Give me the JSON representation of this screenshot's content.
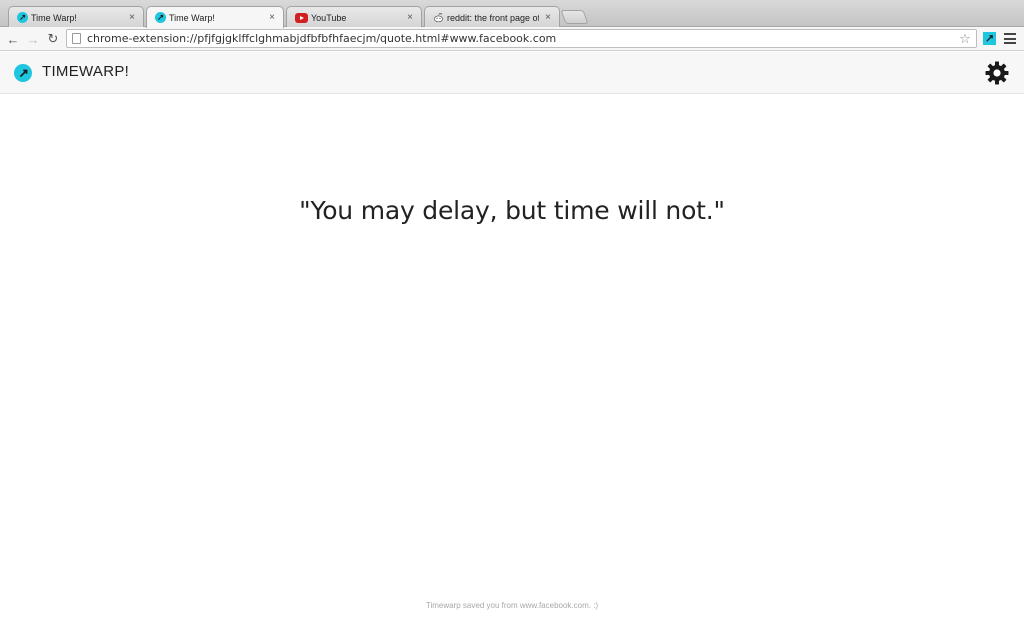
{
  "tabs": [
    {
      "title": "Time Warp!",
      "icon": "timewarp-favicon",
      "active": false
    },
    {
      "title": "Time Warp!",
      "icon": "timewarp-favicon",
      "active": true
    },
    {
      "title": "YouTube",
      "icon": "youtube-favicon",
      "active": false
    },
    {
      "title": "reddit: the front page of th",
      "icon": "reddit-favicon",
      "active": false
    }
  ],
  "tab_close_glyph": "×",
  "toolbar": {
    "url": "chrome-extension://pfjfgjgklffclghmabjdfbfbfhfaecjm/quote.html#www.facebook.com",
    "back_glyph": "←",
    "forward_glyph": "→",
    "reload_glyph": "↻",
    "star_glyph": "☆"
  },
  "app": {
    "title": "TIMEWARP!",
    "accent_color": "#1ec6e0"
  },
  "main": {
    "quote": "\"You may delay, but time will not.\""
  },
  "footer": {
    "text": "Timewarp saved you from www.facebook.com. :)"
  }
}
